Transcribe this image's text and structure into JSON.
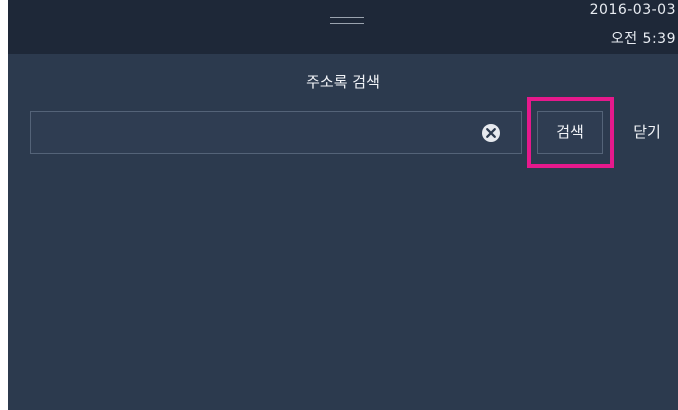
{
  "status_bar": {
    "date": "2016-03-03",
    "time": "오전 5:39"
  },
  "dialog": {
    "title": "주소록 검색"
  },
  "search": {
    "value": "",
    "button_label": "검색",
    "close_label": "닫기"
  },
  "icons": {
    "clear": "clear-circle-x-icon",
    "handle": "drag-handle-icon"
  },
  "colors": {
    "background": "#2c3a4e",
    "status_bar": "#1e2838",
    "highlight": "#e6198c"
  }
}
